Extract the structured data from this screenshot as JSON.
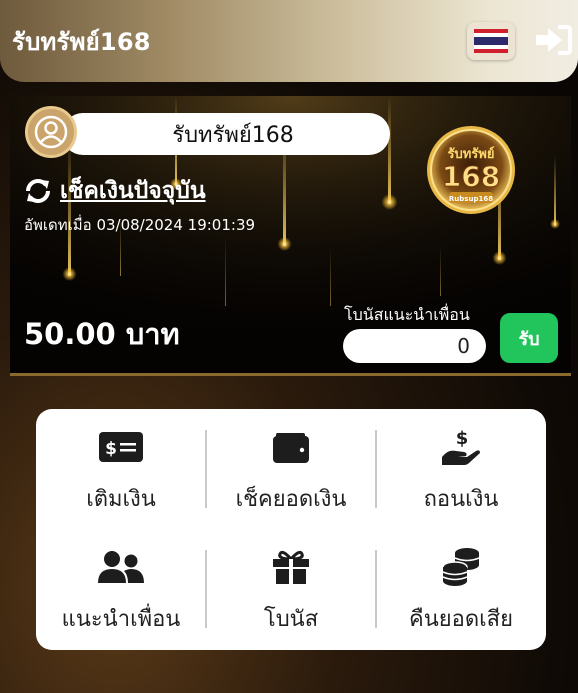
{
  "header": {
    "title": "รับทรัพย์168",
    "language_icon": "thailand-flag-icon",
    "logout_icon": "sign-out-icon"
  },
  "balance_card": {
    "username": "รับทรัพย์168",
    "avatar_icon": "user-circle-icon",
    "refresh_icon": "refresh-icon",
    "check_balance_label": "เช็คเงินปัจจุบัน",
    "updated_at": "อัพเดทเมื่อ 03/08/2024 19:01:39",
    "balance": "50.00 บาท",
    "referral_bonus_label": "โบนัสแนะนำเพื่อน",
    "referral_bonus_value": "0",
    "receive_button": "รับ",
    "brand_logo": {
      "line1": "รับทรัพย์",
      "line2": "168",
      "line3": "Rubsup168"
    }
  },
  "menu": [
    {
      "label": "เติมเงิน",
      "icon": "money-bill-icon"
    },
    {
      "label": "เช็คยอดเงิน",
      "icon": "wallet-icon"
    },
    {
      "label": "ถอนเงิน",
      "icon": "hand-holding-dollar-icon"
    },
    {
      "label": "แนะนำเพื่อน",
      "icon": "users-icon"
    },
    {
      "label": "โบนัส",
      "icon": "gift-icon"
    },
    {
      "label": "คืนยอดเสีย",
      "icon": "coins-icon"
    }
  ],
  "colors": {
    "accent_gold": "#d8b46a",
    "receive_green": "#22c45c"
  }
}
